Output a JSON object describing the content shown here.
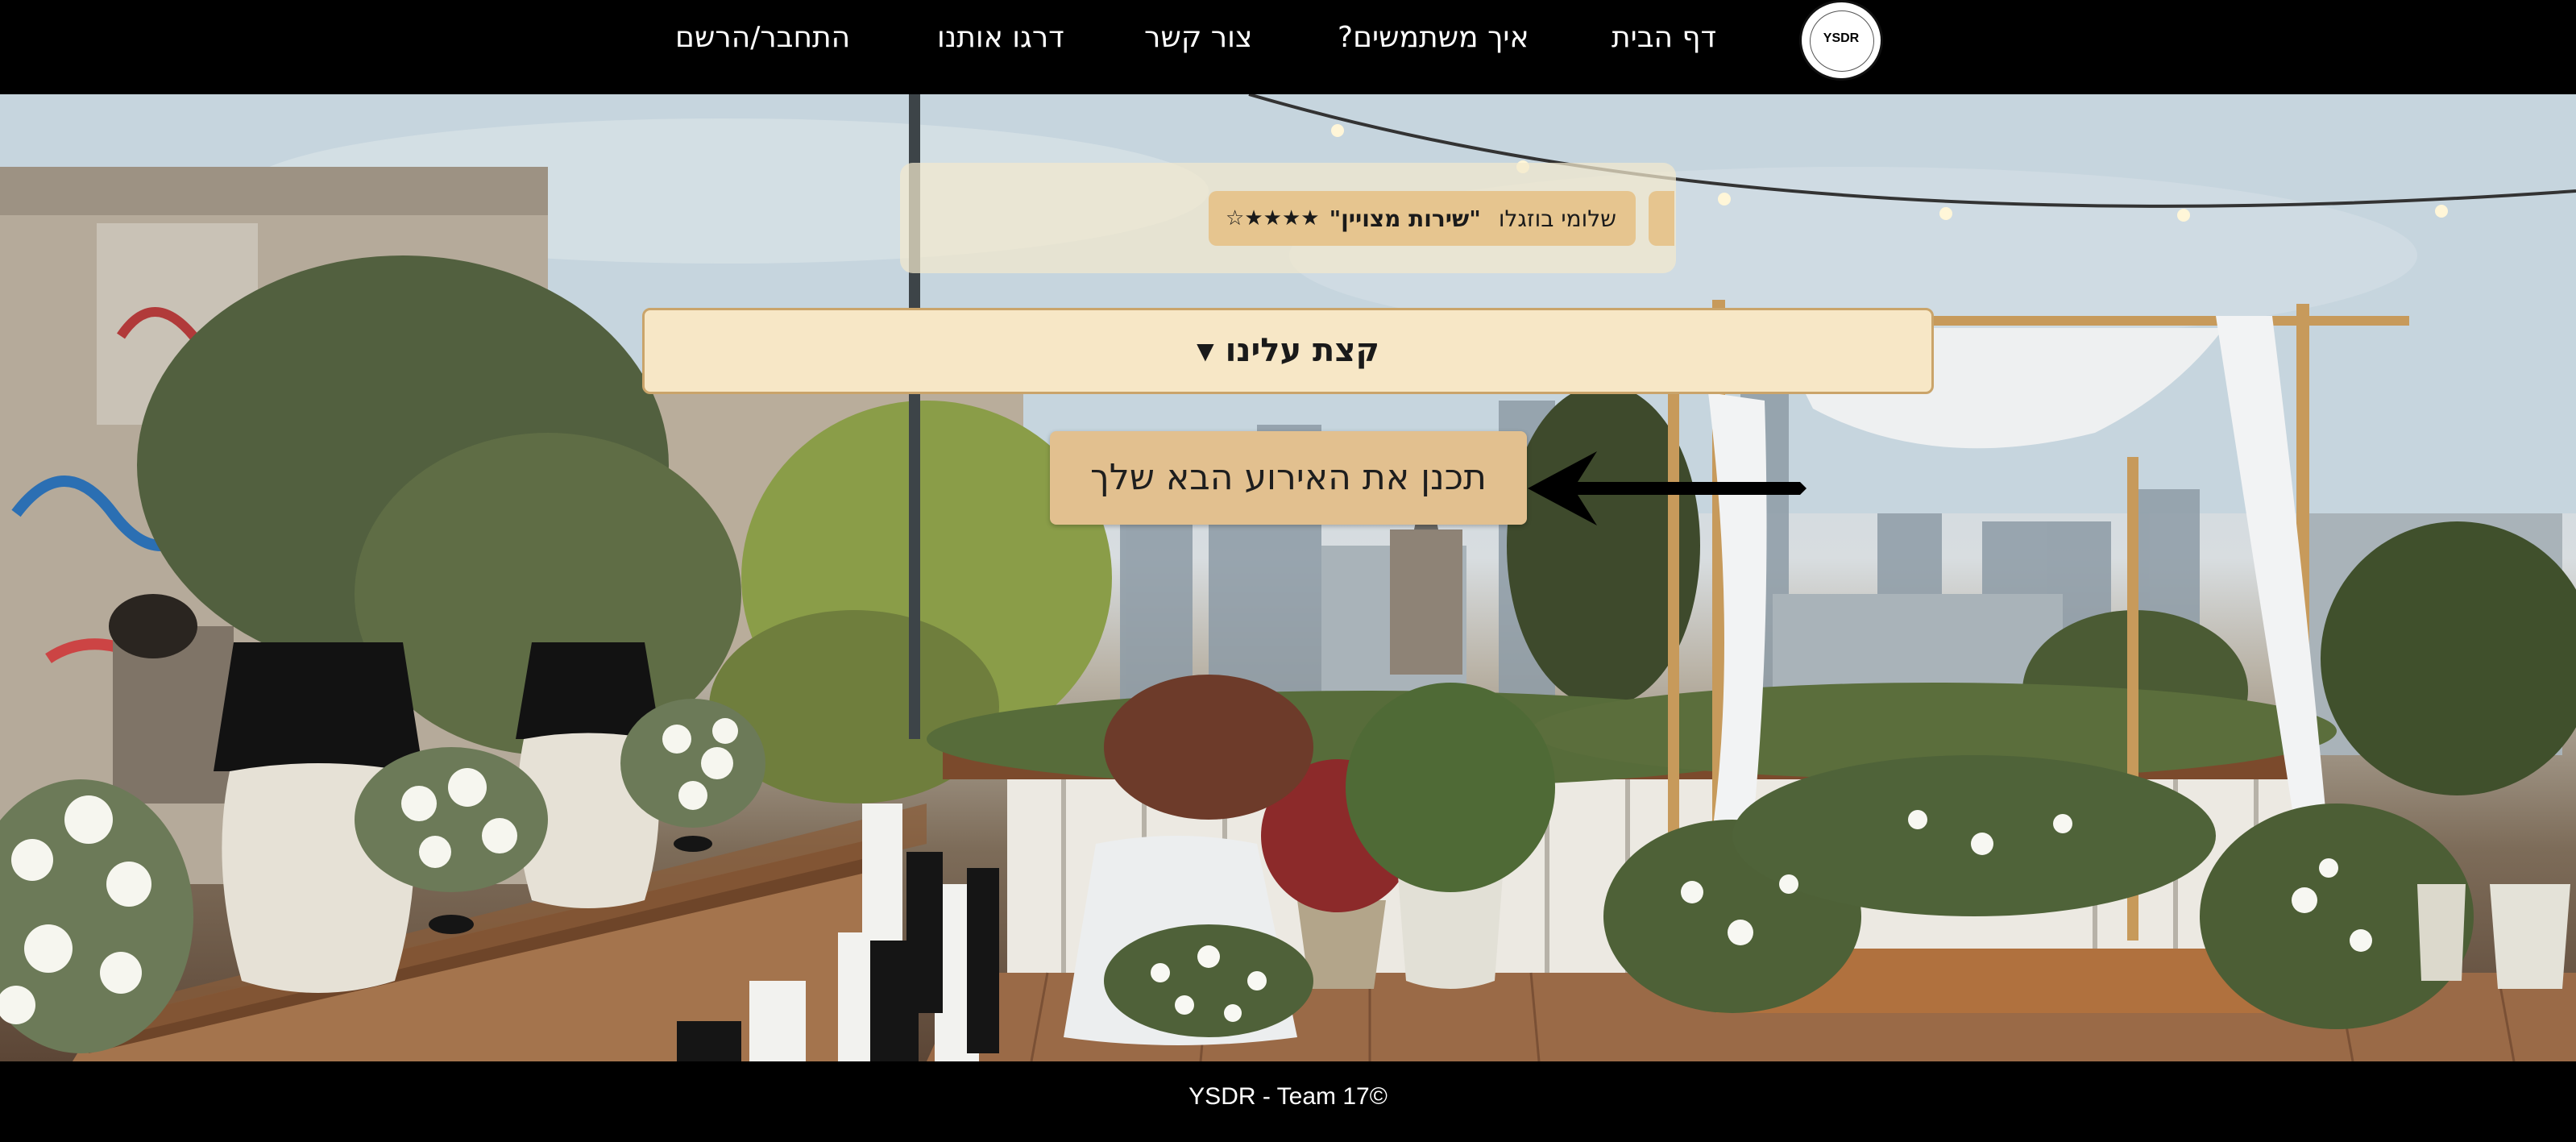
{
  "nav": {
    "home": "דף הבית",
    "how_to_use": "איך משתמשים?",
    "contact": "צור קשר",
    "rate_us": "דרגו אותנו",
    "login_register": "התחבר/הרשם",
    "logo_text": "YSDR"
  },
  "reviews": {
    "items": [
      {
        "name": "שלומי בוזגלו",
        "text": "\"שירות מצויין\"",
        "stars": "★★★★☆"
      }
    ]
  },
  "about": {
    "label": "קצת עלינו",
    "caret": "▼"
  },
  "cta": {
    "label": "תכנן את האירוע הבא שלך"
  },
  "footer": {
    "text": "YSDR - Team 17©"
  },
  "colors": {
    "nav_bg": "#000000",
    "accent_beige": "#e2c08f",
    "about_bg": "#f7e7c6",
    "about_border": "#caa46a",
    "text_light": "#ffffff"
  },
  "icons": {
    "logo": "ysdr-circular-logo",
    "arrow": "left-pointing-arrow-icon",
    "caret": "caret-down-icon"
  }
}
